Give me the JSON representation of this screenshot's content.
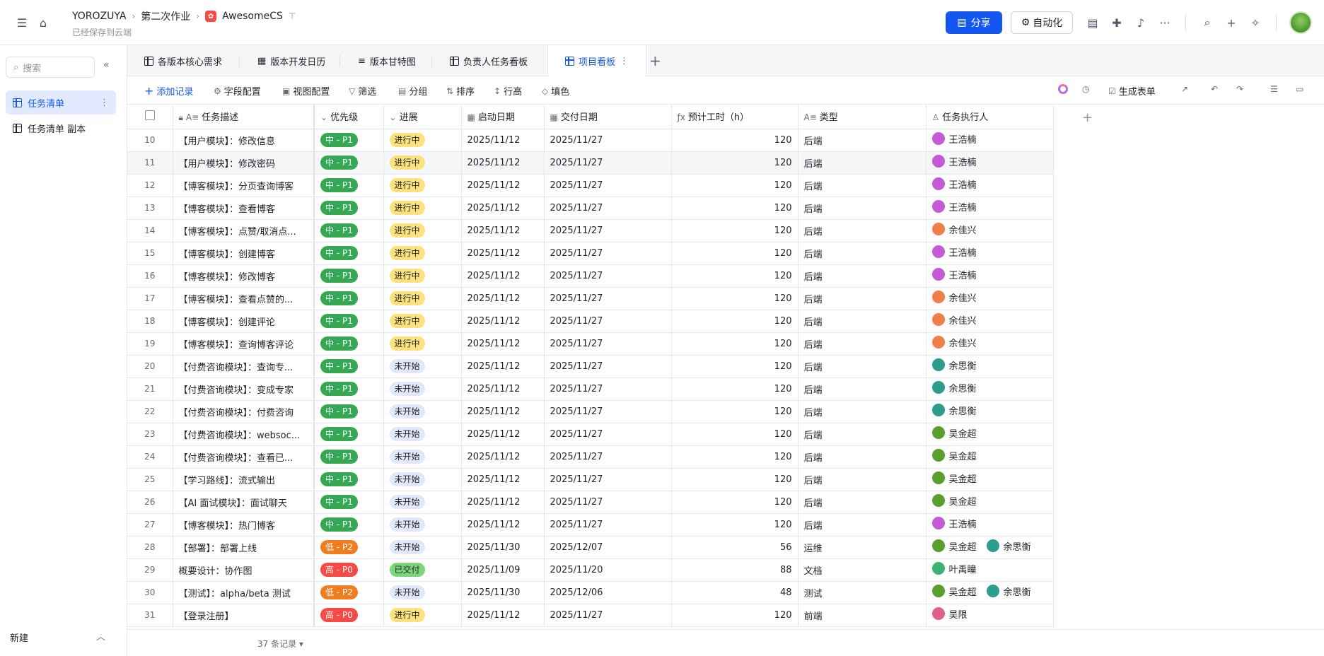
{
  "topbar": {
    "breadcrumb": [
      "YOROZUYA",
      "第二次作业",
      "AwesomeCS"
    ],
    "saved": "已经保存到云端",
    "share_label": "分享",
    "automation_label": "自动化"
  },
  "sidebar": {
    "search_placeholder": "搜索",
    "items": [
      {
        "label": "任务清单"
      },
      {
        "label": "任务清单 副本"
      }
    ],
    "new_label": "新建"
  },
  "tabs": [
    "各版本核心需求",
    "版本开发日历",
    "版本甘特图",
    "负责人任务看板",
    "项目看板"
  ],
  "toolbar": {
    "add_record": "添加记录",
    "field_config": "字段配置",
    "view_config": "视图配置",
    "filter": "筛选",
    "group": "分组",
    "sort": "排序",
    "row_height": "行高",
    "fill": "填色",
    "gen_form": "生成表单"
  },
  "columns": [
    "任务描述",
    "优先级",
    "进展",
    "启动日期",
    "交付日期",
    "预计工时（h）",
    "类型",
    "任务执行人"
  ],
  "rows": [
    {
      "n": "10",
      "task": "【用户模块】：修改信息",
      "pri": "中 - P1",
      "status": "进行中",
      "start": "2025/11/12",
      "due": "2025/11/27",
      "hours": "120",
      "type": "后端",
      "people": [
        "王浩楠"
      ]
    },
    {
      "n": "11",
      "task": "【用户模块】：修改密码",
      "pri": "中 - P1",
      "status": "进行中",
      "start": "2025/11/12",
      "due": "2025/11/27",
      "hours": "120",
      "type": "后端",
      "people": [
        "王浩楠"
      ]
    },
    {
      "n": "12",
      "task": "【博客模块】：分页查询博客",
      "pri": "中 - P1",
      "status": "进行中",
      "start": "2025/11/12",
      "due": "2025/11/27",
      "hours": "120",
      "type": "后端",
      "people": [
        "王浩楠"
      ]
    },
    {
      "n": "13",
      "task": "【博客模块】：查看博客",
      "pri": "中 - P1",
      "status": "进行中",
      "start": "2025/11/12",
      "due": "2025/11/27",
      "hours": "120",
      "type": "后端",
      "people": [
        "王浩楠"
      ]
    },
    {
      "n": "14",
      "task": "【博客模块】：点赞/取消点...",
      "pri": "中 - P1",
      "status": "进行中",
      "start": "2025/11/12",
      "due": "2025/11/27",
      "hours": "120",
      "type": "后端",
      "people": [
        "余佳兴"
      ]
    },
    {
      "n": "15",
      "task": "【博客模块】：创建博客",
      "pri": "中 - P1",
      "status": "进行中",
      "start": "2025/11/12",
      "due": "2025/11/27",
      "hours": "120",
      "type": "后端",
      "people": [
        "王浩楠"
      ]
    },
    {
      "n": "16",
      "task": "【博客模块】：修改博客",
      "pri": "中 - P1",
      "status": "进行中",
      "start": "2025/11/12",
      "due": "2025/11/27",
      "hours": "120",
      "type": "后端",
      "people": [
        "王浩楠"
      ]
    },
    {
      "n": "17",
      "task": "【博客模块】：查看点赞的...",
      "pri": "中 - P1",
      "status": "进行中",
      "start": "2025/11/12",
      "due": "2025/11/27",
      "hours": "120",
      "type": "后端",
      "people": [
        "余佳兴"
      ]
    },
    {
      "n": "18",
      "task": "【博客模块】：创建评论",
      "pri": "中 - P1",
      "status": "进行中",
      "start": "2025/11/12",
      "due": "2025/11/27",
      "hours": "120",
      "type": "后端",
      "people": [
        "余佳兴"
      ]
    },
    {
      "n": "19",
      "task": "【博客模块】：查询博客评论",
      "pri": "中 - P1",
      "status": "进行中",
      "start": "2025/11/12",
      "due": "2025/11/27",
      "hours": "120",
      "type": "后端",
      "people": [
        "余佳兴"
      ]
    },
    {
      "n": "20",
      "task": "【付费咨询模块】：查询专...",
      "pri": "中 - P1",
      "status": "未开始",
      "start": "2025/11/12",
      "due": "2025/11/27",
      "hours": "120",
      "type": "后端",
      "people": [
        "余思衡"
      ]
    },
    {
      "n": "21",
      "task": "【付费咨询模块】：变成专家",
      "pri": "中 - P1",
      "status": "未开始",
      "start": "2025/11/12",
      "due": "2025/11/27",
      "hours": "120",
      "type": "后端",
      "people": [
        "余思衡"
      ]
    },
    {
      "n": "22",
      "task": "【付费咨询模块】：付费咨询",
      "pri": "中 - P1",
      "status": "未开始",
      "start": "2025/11/12",
      "due": "2025/11/27",
      "hours": "120",
      "type": "后端",
      "people": [
        "余思衡"
      ]
    },
    {
      "n": "23",
      "task": "【付费咨询模块】：websoc...",
      "pri": "中 - P1",
      "status": "未开始",
      "start": "2025/11/12",
      "due": "2025/11/27",
      "hours": "120",
      "type": "后端",
      "people": [
        "吴金超"
      ]
    },
    {
      "n": "24",
      "task": "【付费咨询模块】：查看已...",
      "pri": "中 - P1",
      "status": "未开始",
      "start": "2025/11/12",
      "due": "2025/11/27",
      "hours": "120",
      "type": "后端",
      "people": [
        "吴金超"
      ]
    },
    {
      "n": "25",
      "task": "【学习路线】：流式输出",
      "pri": "中 - P1",
      "status": "未开始",
      "start": "2025/11/12",
      "due": "2025/11/27",
      "hours": "120",
      "type": "后端",
      "people": [
        "吴金超"
      ]
    },
    {
      "n": "26",
      "task": "【AI 面试模块】：面试聊天",
      "pri": "中 - P1",
      "status": "未开始",
      "start": "2025/11/12",
      "due": "2025/11/27",
      "hours": "120",
      "type": "后端",
      "people": [
        "吴金超"
      ]
    },
    {
      "n": "27",
      "task": "【博客模块】：热门博客",
      "pri": "中 - P1",
      "status": "未开始",
      "start": "2025/11/12",
      "due": "2025/11/27",
      "hours": "120",
      "type": "后端",
      "people": [
        "王浩楠"
      ]
    },
    {
      "n": "28",
      "task": "【部署】：部署上线",
      "pri": "低 - P2",
      "status": "未开始",
      "start": "2025/11/30",
      "due": "2025/12/07",
      "hours": "56",
      "type": "运维",
      "people": [
        "吴金超",
        "余思衡"
      ]
    },
    {
      "n": "29",
      "task": "概要设计：协作图",
      "pri": "高 - P0",
      "status": "已交付",
      "start": "2025/11/09",
      "due": "2025/11/20",
      "hours": "88",
      "type": "文档",
      "people": [
        "叶禹瞳"
      ]
    },
    {
      "n": "30",
      "task": "【测试】：alpha/beta 测试",
      "pri": "低 - P2",
      "status": "未开始",
      "start": "2025/11/30",
      "due": "2025/12/06",
      "hours": "48",
      "type": "测试",
      "people": [
        "吴金超",
        "余思衡"
      ]
    },
    {
      "n": "31",
      "task": "【登录注册】",
      "pri": "高 - P0",
      "status": "进行中",
      "start": "2025/11/12",
      "due": "2025/11/27",
      "hours": "120",
      "type": "前端",
      "people": [
        "吴限"
      ]
    }
  ],
  "footer": {
    "count": "37 条记录"
  },
  "colors": {
    "accent": "#1456f0",
    "mid": "#34a853",
    "low": "#f07e1e",
    "high": "#f54a45"
  }
}
